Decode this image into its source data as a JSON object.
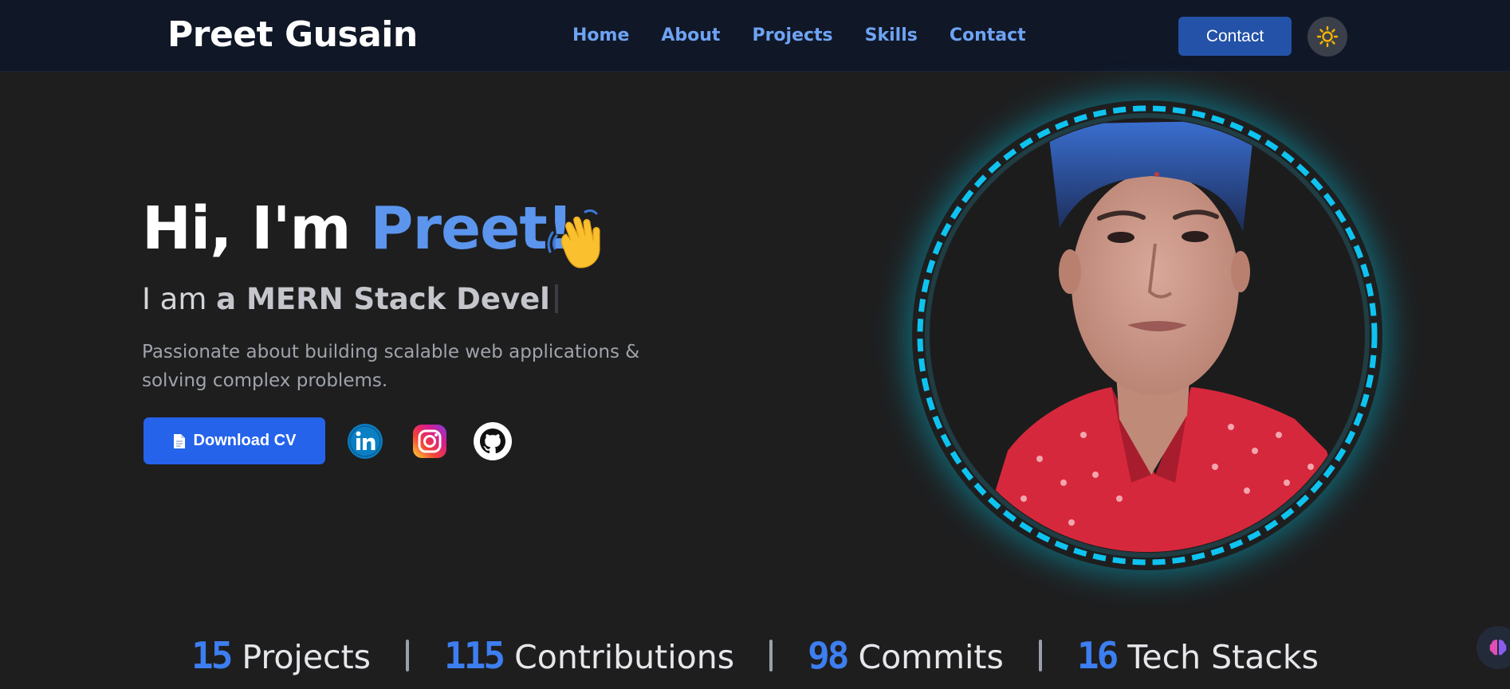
{
  "nav": {
    "brand": "Preet Gusain",
    "links": [
      "Home",
      "About",
      "Projects",
      "Skills",
      "Contact"
    ],
    "contact_button": "Contact",
    "theme_icon": "sun-icon"
  },
  "hero": {
    "greeting_prefix": "Hi, I'm ",
    "greeting_name": "Preet!",
    "typing_prefix": "I am ",
    "typing_text": "a MERN Stack Devel",
    "tagline": "Passionate about building scalable web applications & solving complex problems.",
    "download_button": "Download CV",
    "socials": [
      "linkedin-icon",
      "instagram-icon",
      "github-icon"
    ],
    "portrait": "profile-photo"
  },
  "stats": [
    {
      "number": "15",
      "label": "Projects"
    },
    {
      "number": "115",
      "label": "Contributions"
    },
    {
      "number": "98",
      "label": "Commits"
    },
    {
      "number": "16",
      "label": "Tech Stacks"
    }
  ],
  "colors": {
    "accent": "#5b95ee",
    "nav_bg": "#101727",
    "page_bg": "#1e1e1f",
    "button": "#2563eb",
    "ring": "#0ec3f0"
  }
}
